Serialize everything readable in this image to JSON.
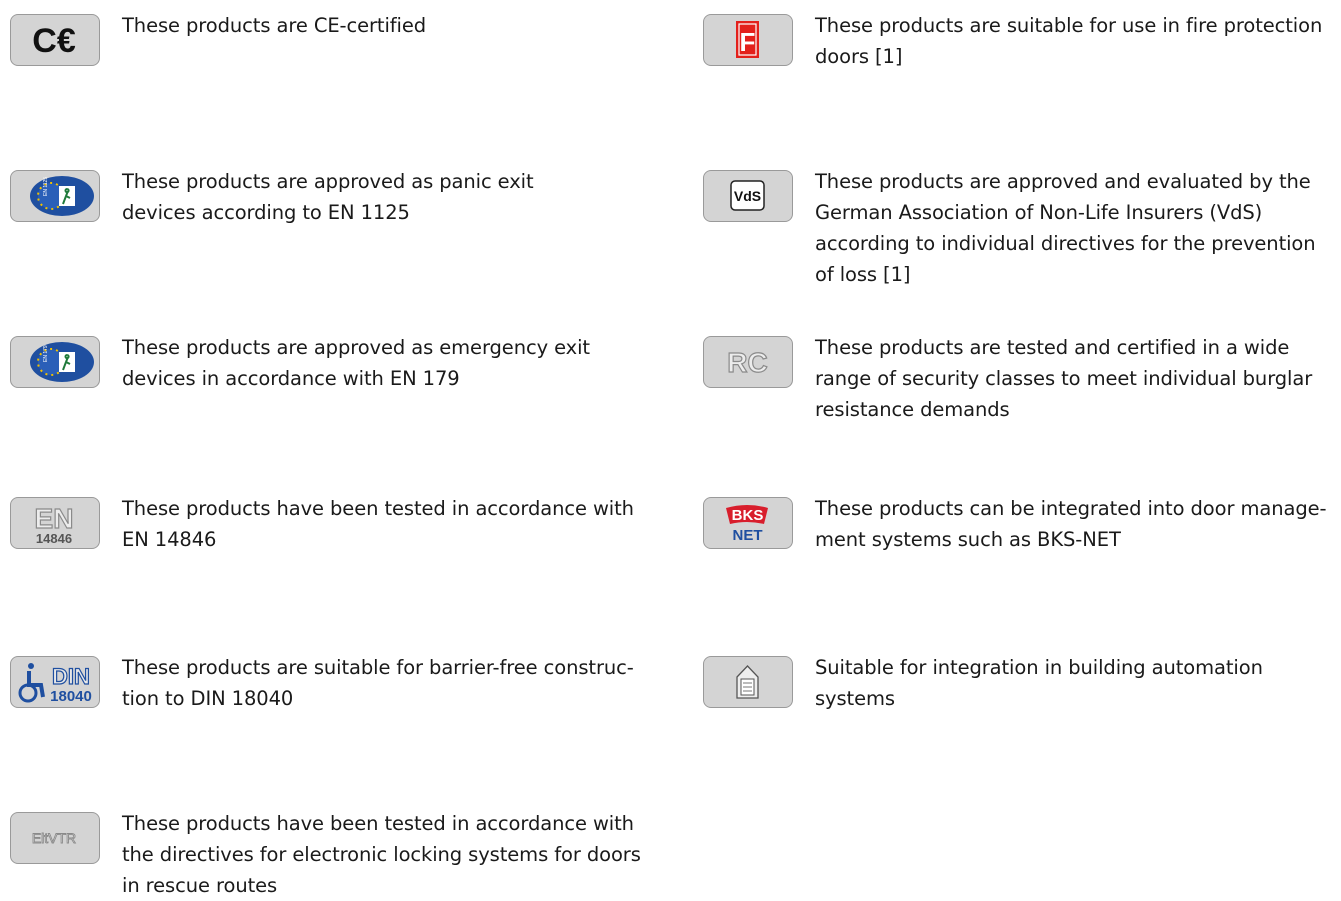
{
  "left_column": [
    {
      "icon": "ce-mark-icon",
      "text_lines": [
        "These products are CE-certified"
      ]
    },
    {
      "icon": "en1125-panic-exit-icon",
      "icon_text": "EN 1125",
      "text_lines": [
        "These products are approved as panic exit",
        "devices according to EN 1125"
      ]
    },
    {
      "icon": "en179-emergency-exit-icon",
      "icon_text": "EN 179",
      "text_lines": [
        "These products are approved as emergency exit",
        "devices in accordance with EN 179"
      ]
    },
    {
      "icon": "en14846-icon",
      "icon_text": "EN",
      "icon_subtext": "14846",
      "text_lines": [
        "These products have been tested in accordance with",
        "EN 14846"
      ]
    },
    {
      "icon": "din18040-barrier-free-icon",
      "icon_text": "DIN",
      "icon_subtext": "18040",
      "text_lines": [
        "These products are suitable for barrier-free construc-",
        "tion to DIN 18040"
      ]
    },
    {
      "icon": "eltvtr-icon",
      "icon_text": "EltVTR",
      "text_lines": [
        "These products have been tested in accordance with",
        "the directives for electronic locking systems for doors",
        "in rescue routes"
      ]
    }
  ],
  "right_column": [
    {
      "icon": "fire-protection-f-icon",
      "icon_text": "F",
      "text_lines": [
        "These products are suitable for use in fire protection",
        "doors [1]"
      ]
    },
    {
      "icon": "vds-icon",
      "icon_text": "VdS",
      "text_lines": [
        "These products are approved and evaluated by the",
        "German Association of Non-Life Insurers (VdS)",
        "according to individual directives for the prevention",
        "of loss [1]"
      ]
    },
    {
      "icon": "rc-icon",
      "icon_text": "RC",
      "text_lines": [
        "These products are tested and certified in a wide",
        "range of security classes to meet individual burglar",
        "resistance demands"
      ]
    },
    {
      "icon": "bks-net-icon",
      "icon_text": "BKS",
      "icon_subtext": "NET",
      "text_lines": [
        "These products can be integrated into door manage-",
        "ment systems such as BKS-NET"
      ]
    },
    {
      "icon": "building-automation-icon",
      "text_lines": [
        "Suitable for integration in building automation",
        "systems"
      ]
    }
  ],
  "colors": {
    "badge_bg": "#d4d4d4",
    "badge_border": "#9a9a9a",
    "fire_red": "#e3201b",
    "eu_blue": "#1f4fa0",
    "bks_red": "#d81e2c",
    "text": "#1a1a1a"
  }
}
